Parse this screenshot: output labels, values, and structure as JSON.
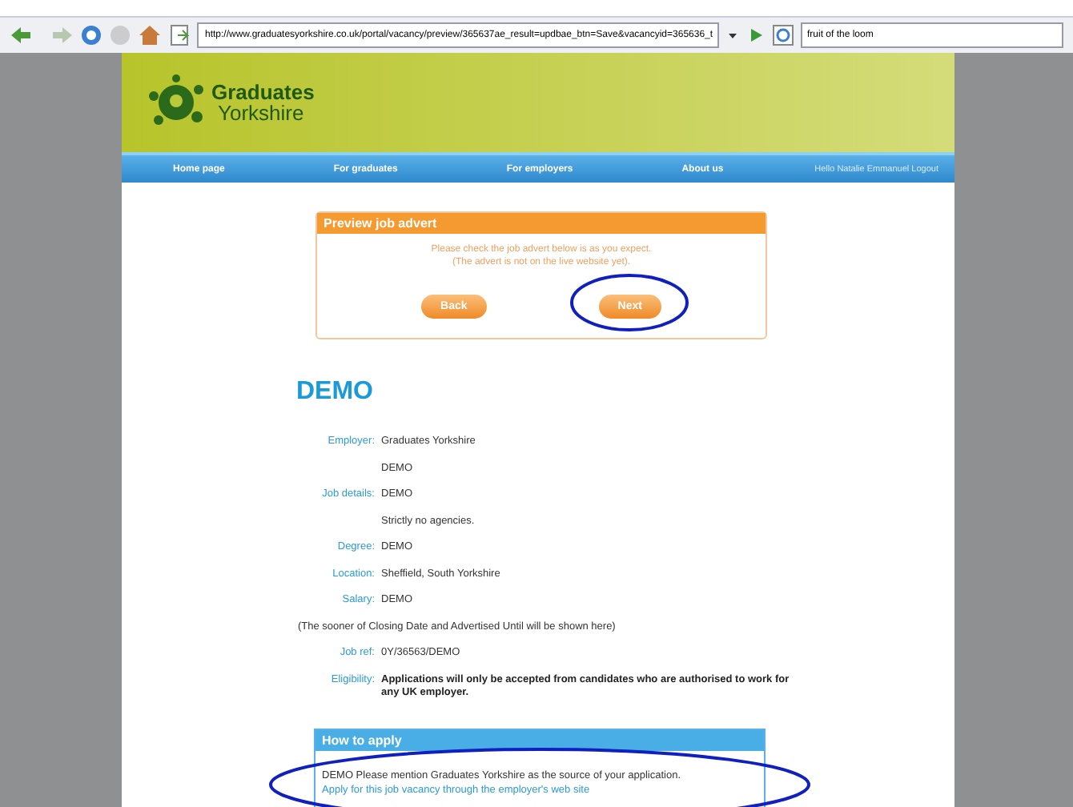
{
  "browser": {
    "url": "http://www.graduatesyorkshire.co.uk/portal/vacancy/preview/365637ae_result=updbae_btn=Save&vacancyid=365636_t",
    "search": "fruit of the loom"
  },
  "site": {
    "logo_line1": "Graduates",
    "logo_line2": "Yorkshire",
    "nav": [
      "Home page",
      "For graduates",
      "For employers",
      "About us"
    ],
    "greeting": "Hello Natalie Emmanuel Logout"
  },
  "preview": {
    "title": "Preview job advert",
    "message": [
      "Please check the job advert below is as you expect.",
      "(The advert is not on the live website yet)."
    ],
    "buttons": [
      "Back",
      "Next"
    ]
  },
  "job": {
    "title": "DEMO",
    "rows": [
      {
        "kind": "field",
        "label": "Employer:",
        "value": "Graduates Yorkshire"
      },
      {
        "kind": "continuation",
        "value": "DEMO"
      },
      {
        "kind": "field",
        "label": "Job details:",
        "value": "DEMO"
      },
      {
        "kind": "continuation",
        "value": "Strictly no agencies."
      },
      {
        "kind": "field",
        "label": "Degree:",
        "value": "DEMO"
      },
      {
        "kind": "field",
        "label": "Location:",
        "value": "Sheffield, South Yorkshire"
      },
      {
        "kind": "field",
        "label": "Salary:",
        "value": "DEMO"
      },
      {
        "kind": "note",
        "value": "(The sooner of Closing Date and Advertised Until will be shown here)"
      },
      {
        "kind": "field",
        "label": "Job ref:",
        "value": "0Y/36563/DEMO"
      },
      {
        "kind": "strong",
        "label": "Eligibility:",
        "value": "Applications will only be accepted from candidates who are authorised to work for any UK employer."
      }
    ]
  },
  "apply": {
    "title": "How to apply",
    "text": "DEMO Please mention Graduates Yorkshire as the source of your application.",
    "link": "Apply for this job vacancy through the employer's web site"
  }
}
